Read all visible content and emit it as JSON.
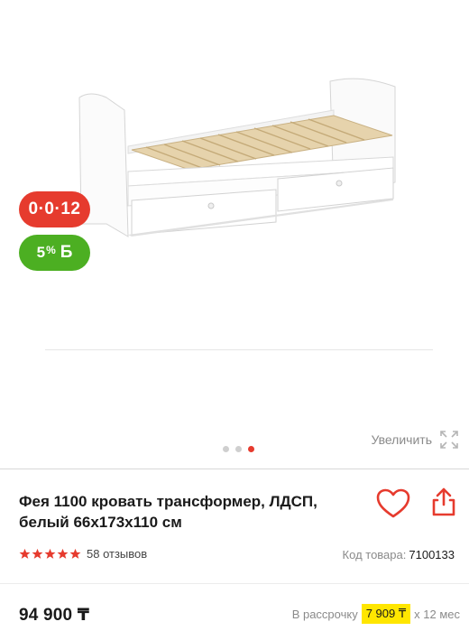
{
  "badges": {
    "installment": "0·0·12",
    "bonus_percent": "5",
    "bonus_pct_sign": "%",
    "bonus_letter": "Б"
  },
  "gallery": {
    "zoom_label": "Увеличить",
    "slides_total": 3,
    "active_slide": 3
  },
  "product": {
    "title": "Фея 1100 кровать трансформер, ЛДСП, белый 66х173х110 см",
    "rating": 5,
    "reviews": "58 отзывов",
    "code_label": "Код товара:",
    "code_value": "7100133",
    "price": "94 900 ₸"
  },
  "installment": {
    "prefix": "В рассрочку",
    "amount": "7 909 ₸",
    "suffix": "х 12 мес"
  },
  "colors": {
    "accent_red": "#e63b2e",
    "bonus_green": "#4caf22",
    "installment_highlight": "#ffe600"
  },
  "icons": {
    "favorite": "heart-icon",
    "share": "share-icon",
    "zoom": "expand-icon",
    "rating": "star-icon"
  }
}
